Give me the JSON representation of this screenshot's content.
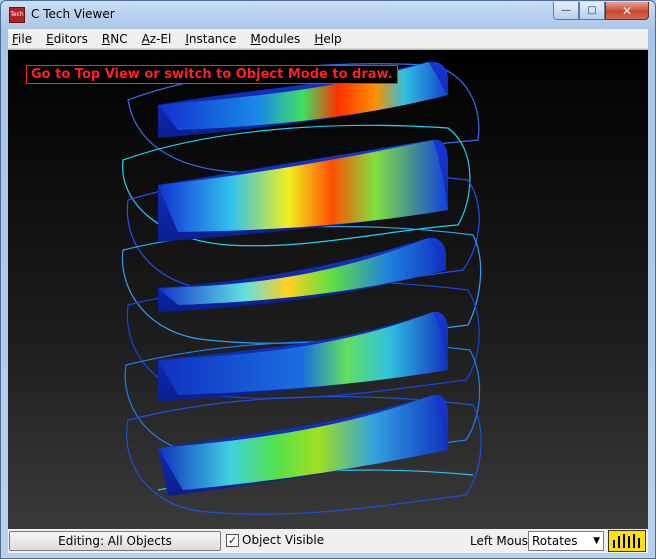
{
  "window": {
    "title": "C Tech Viewer",
    "icon_text": "Tech",
    "buttons": {
      "minimize": "—",
      "maximize": "□",
      "close": "✕"
    }
  },
  "menu": [
    {
      "key": "F",
      "rest": "ile"
    },
    {
      "key": "E",
      "rest": "ditors"
    },
    {
      "key": "R",
      "rest": "NC"
    },
    {
      "key": "A",
      "rest": "z-El"
    },
    {
      "key": "I",
      "rest": "nstance"
    },
    {
      "key": "M",
      "rest": "odules"
    },
    {
      "key": "H",
      "rest": "elp"
    }
  ],
  "viewport": {
    "message": "Go to Top View or switch to Object Mode to draw.",
    "colors": {
      "message": "#ff2020",
      "slab_low": "#1030d0",
      "slab_mid": "#30e030",
      "slab_high": "#ff3000"
    }
  },
  "status": {
    "editing_button": "Editing: All Objects",
    "object_visible_label": "Object Visible",
    "object_visible_checked": true,
    "left_mouse_label": "Left Mouse",
    "left_mouse_value": "Rotates"
  }
}
